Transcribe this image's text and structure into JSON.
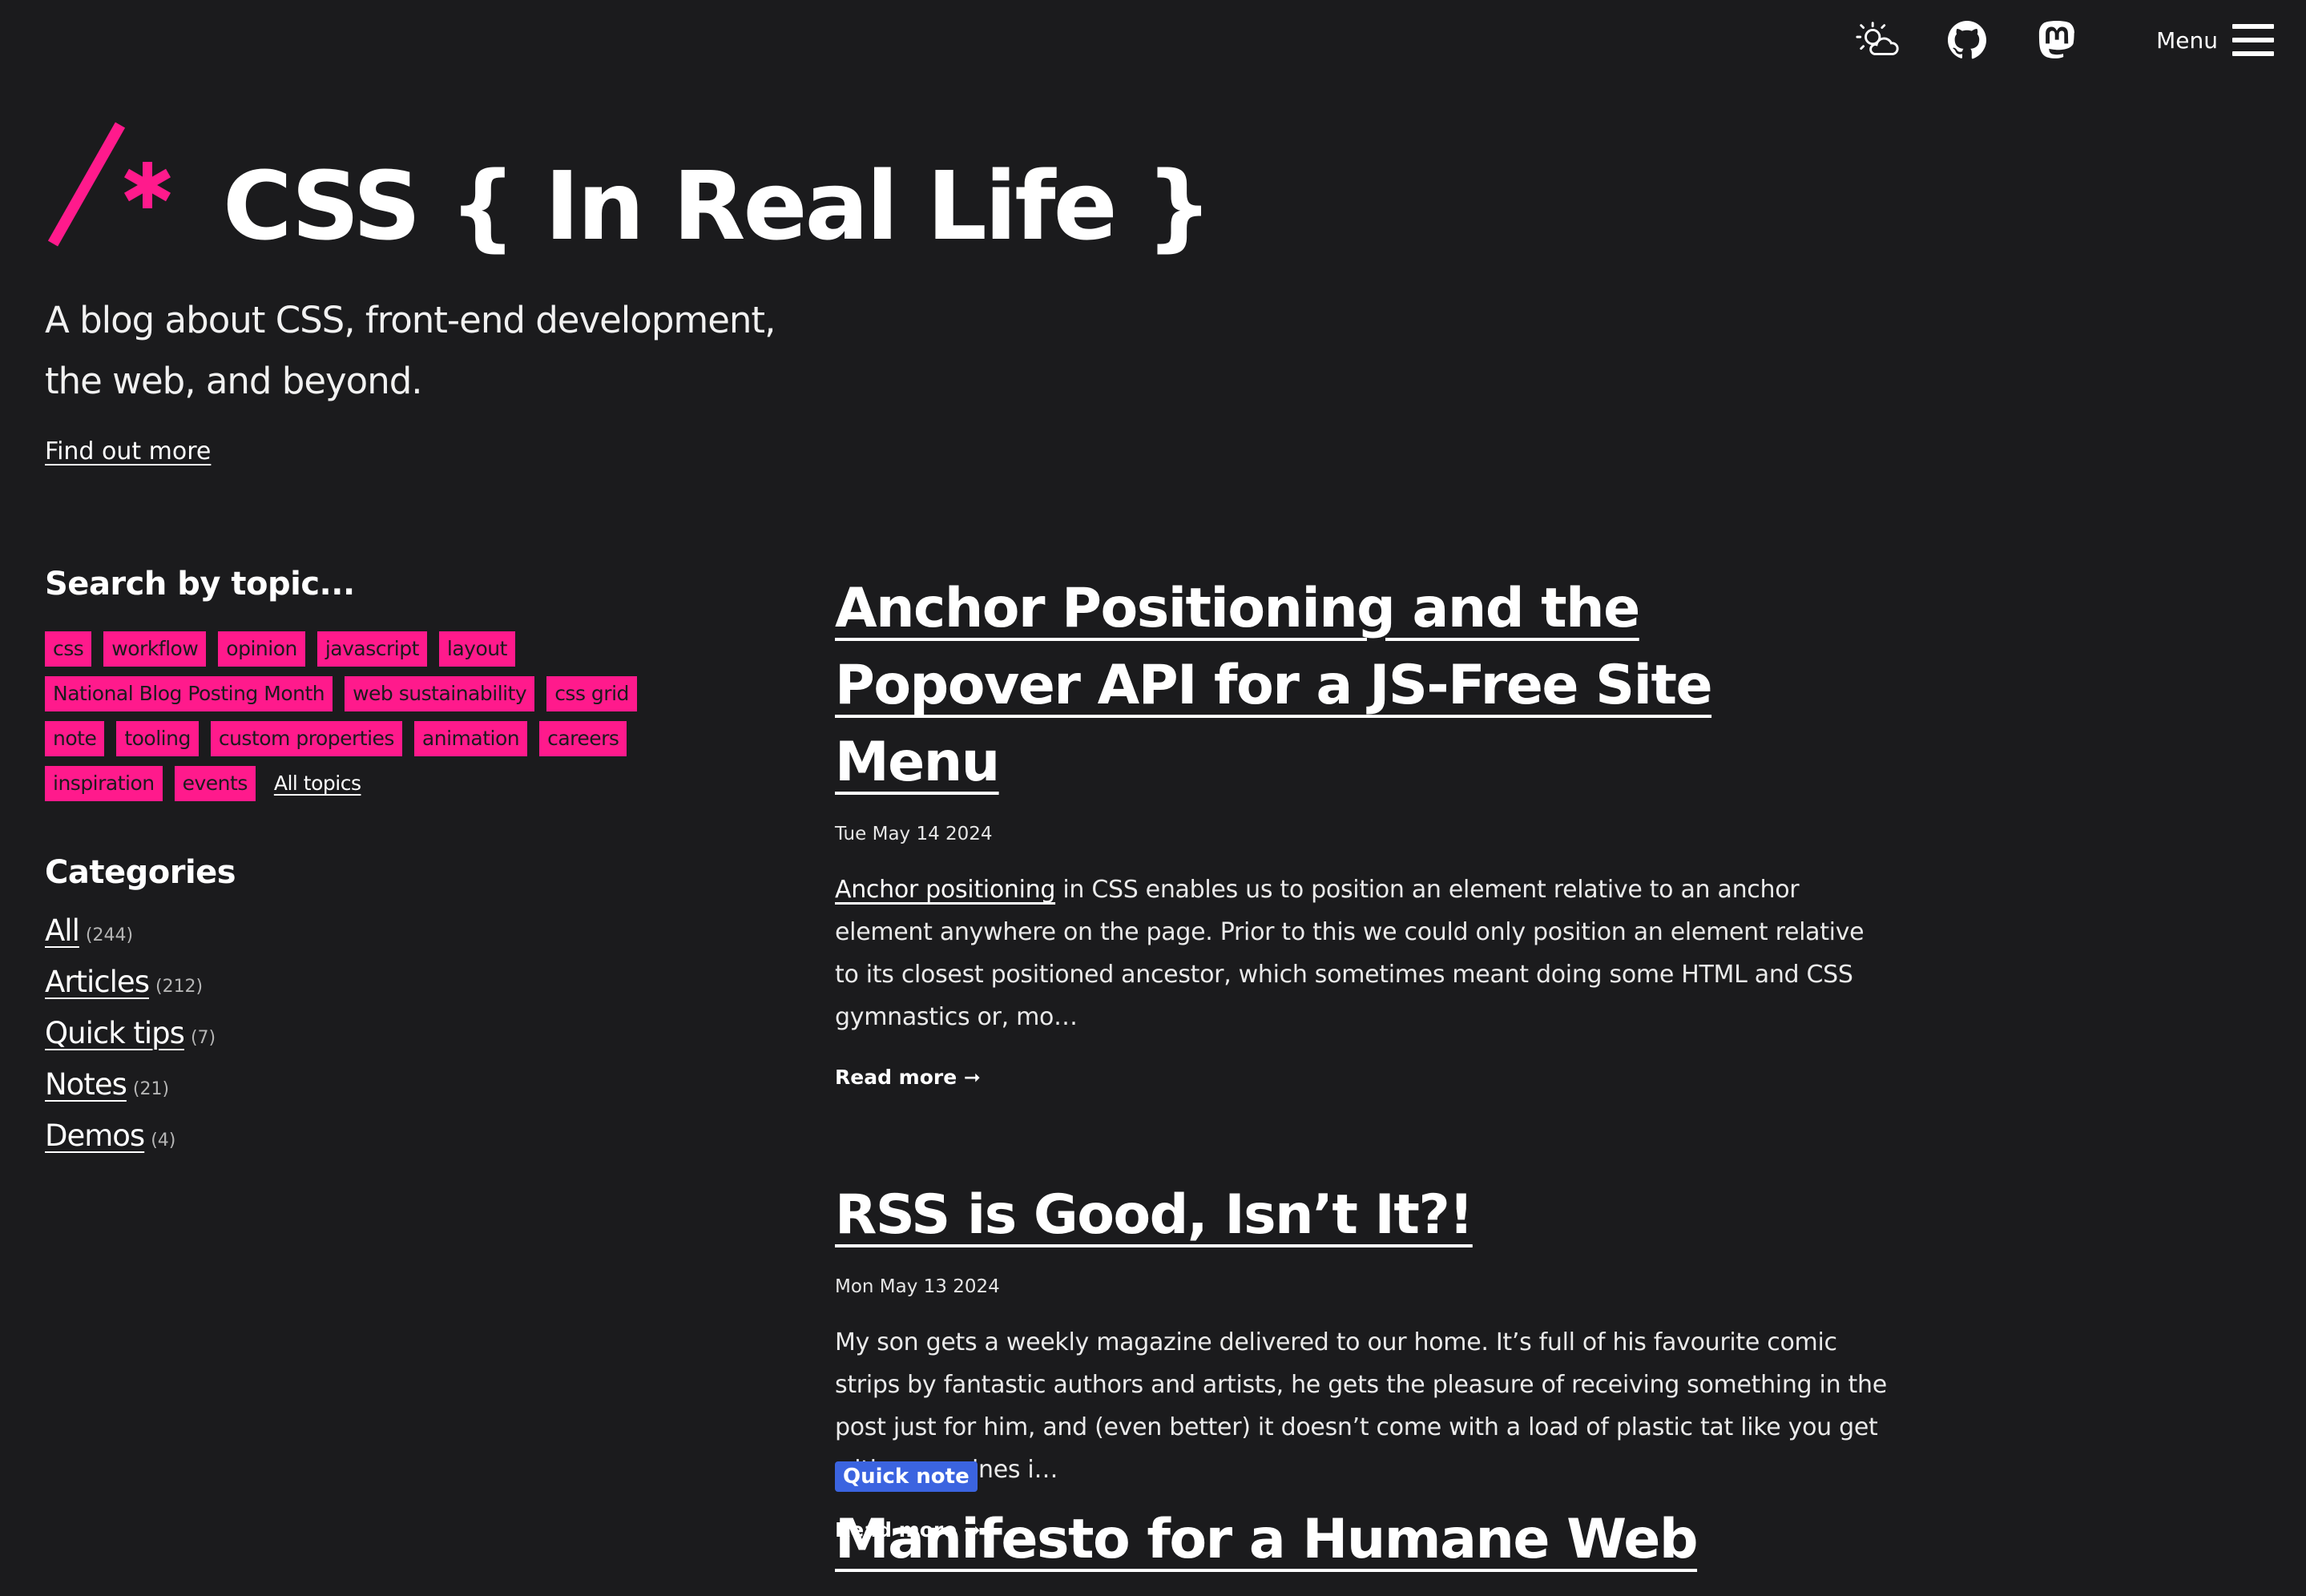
{
  "colors": {
    "background": "#1b1b1d",
    "accent": "#ff1a8c",
    "badge": "#3b64e0",
    "text": "#ffffff"
  },
  "topbar": {
    "icons": [
      "theme-weather-icon",
      "github-icon",
      "mastodon-icon",
      "hamburger-icon"
    ],
    "menu_label": "Menu"
  },
  "header": {
    "title": "CSS { In Real Life }",
    "tagline": "A blog about CSS, front-end development, the web, and beyond.",
    "find_more": "Find out more"
  },
  "sidebar": {
    "topics_heading": "Search by topic...",
    "tags": [
      "css",
      "workflow",
      "opinion",
      "javascript",
      "layout",
      "National Blog Posting Month",
      "web sustainability",
      "css grid",
      "note",
      "tooling",
      "custom properties",
      "animation",
      "careers",
      "inspiration",
      "events"
    ],
    "all_topics": "All topics",
    "categories_heading": "Categories",
    "categories": [
      {
        "label": "All",
        "count": "(244)"
      },
      {
        "label": "Articles",
        "count": "(212)"
      },
      {
        "label": "Quick tips",
        "count": "(7)"
      },
      {
        "label": "Notes",
        "count": "(21)"
      },
      {
        "label": "Demos",
        "count": "(4)"
      }
    ]
  },
  "posts": [
    {
      "title": "Anchor Positioning and the Popover API for a JS-Free Site Menu",
      "date": "Tue May 14 2024",
      "excerpt_link": "Anchor positioning",
      "excerpt": " in CSS enables us to position an element relative to an anchor element anywhere on the page. Prior to this we could only position an element relative to its closest positioned ancestor, which sometimes meant doing some HTML and CSS gymnastics or, mo…",
      "read_more": "Read more ➞"
    },
    {
      "title": "RSS is Good, Isn’t It?!",
      "date": "Mon May 13 2024",
      "excerpt": "My son gets a weekly magazine delivered to our home. It’s full of his favourite comic strips by fantastic authors and artists, he gets the pleasure of receiving something in the post just for him, and (even better) it doesn’t come with a load of plastic tat like you get with magazines i…",
      "read_more": "Read more ➞"
    },
    {
      "badge": "Quick note",
      "title": "Manifesto for a Humane Web"
    }
  ]
}
